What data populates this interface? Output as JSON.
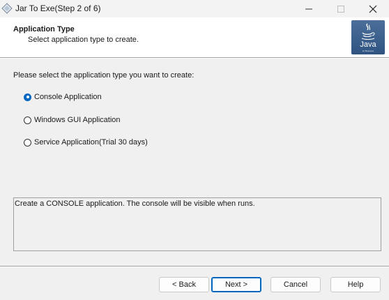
{
  "window": {
    "title": "Jar To Exe(Step 2 of 6)"
  },
  "header": {
    "title": "Application Type",
    "subtitle": "Select application type to create.",
    "logo_text": "Java",
    "logo_subtext": "for Business"
  },
  "main": {
    "prompt": "Please select the application type you want to create:",
    "options": [
      {
        "label": "Console Application",
        "selected": true
      },
      {
        "label": "Windows GUI Application",
        "selected": false
      },
      {
        "label": "Service Application(Trial 30 days)",
        "selected": false
      }
    ],
    "description": "Create a CONSOLE application. The console will be visible when runs."
  },
  "footer": {
    "back_label": "< Back",
    "next_label": "Next >",
    "cancel_label": "Cancel",
    "help_label": "Help"
  },
  "colors": {
    "accent": "#0067c0",
    "logo_bg": "#2f5482"
  },
  "icons": {
    "app": "diamond-app-icon",
    "minimize": "minimize-icon",
    "maximize": "maximize-icon",
    "close": "close-icon",
    "logo": "java-coffee-cup-icon"
  }
}
